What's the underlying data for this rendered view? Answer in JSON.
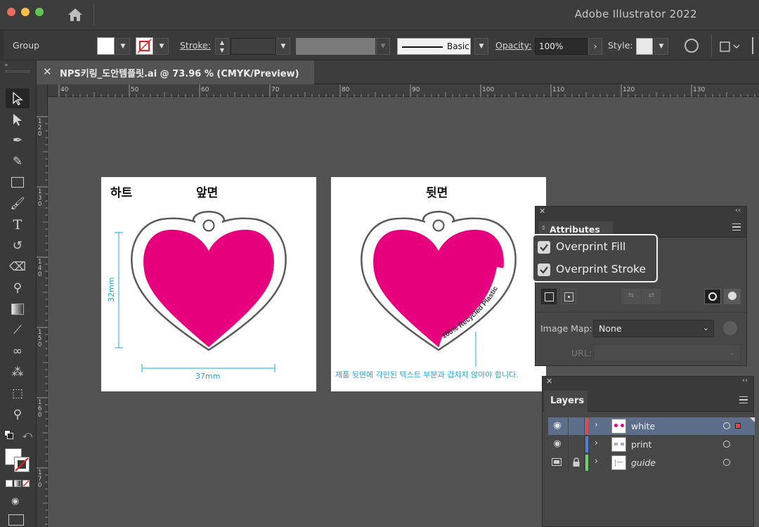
{
  "app": {
    "title": "Adobe Illustrator 2022"
  },
  "control_bar": {
    "selection_label": "Group",
    "stroke_label": "Stroke:",
    "brush_label": "Basic",
    "opacity_label": "Opacity:",
    "opacity_value": "100%",
    "style_label": "Style:"
  },
  "document": {
    "tab_title": "NPS키링_도안템플릿.ai @ 73.96 % (CMYK/Preview)"
  },
  "rulers": {
    "horizontal": [
      "40",
      "50",
      "60",
      "70",
      "80",
      "90",
      "100",
      "110",
      "120",
      "130"
    ],
    "vertical": [
      "120",
      "130",
      "140",
      "150",
      "160",
      "170"
    ]
  },
  "artboards": {
    "front": {
      "shape_label": "하트",
      "side_label": "앞면",
      "height_dim": "32mm",
      "width_dim": "37mm"
    },
    "back": {
      "side_label": "뒷면",
      "engraving": "100% Recycled Plastic",
      "note": "제품 뒷면에 각인된 텍스트 부분과 겹치지 않아야 합니다."
    }
  },
  "attributes_panel": {
    "title": "Attributes",
    "overprint_fill": "Overprint Fill",
    "overprint_stroke": "Overprint Stroke",
    "image_map_label": "Image Map:",
    "image_map_value": "None",
    "url_label": "URL:"
  },
  "layers_panel": {
    "title": "Layers",
    "layers": [
      {
        "name": "white",
        "color": "#e8474a",
        "visible": "eye-icon",
        "selected": true
      },
      {
        "name": "print",
        "color": "#4f7fe0",
        "visible": "eye-icon",
        "selected": false
      },
      {
        "name": "guide",
        "color": "#6cd36c",
        "visible": "template-icon",
        "locked": true,
        "selected": false
      }
    ]
  },
  "colors": {
    "magenta": "#e6007e",
    "dimension_cyan": "#1aa9e0",
    "selection_blue": "#5c6e8a"
  }
}
